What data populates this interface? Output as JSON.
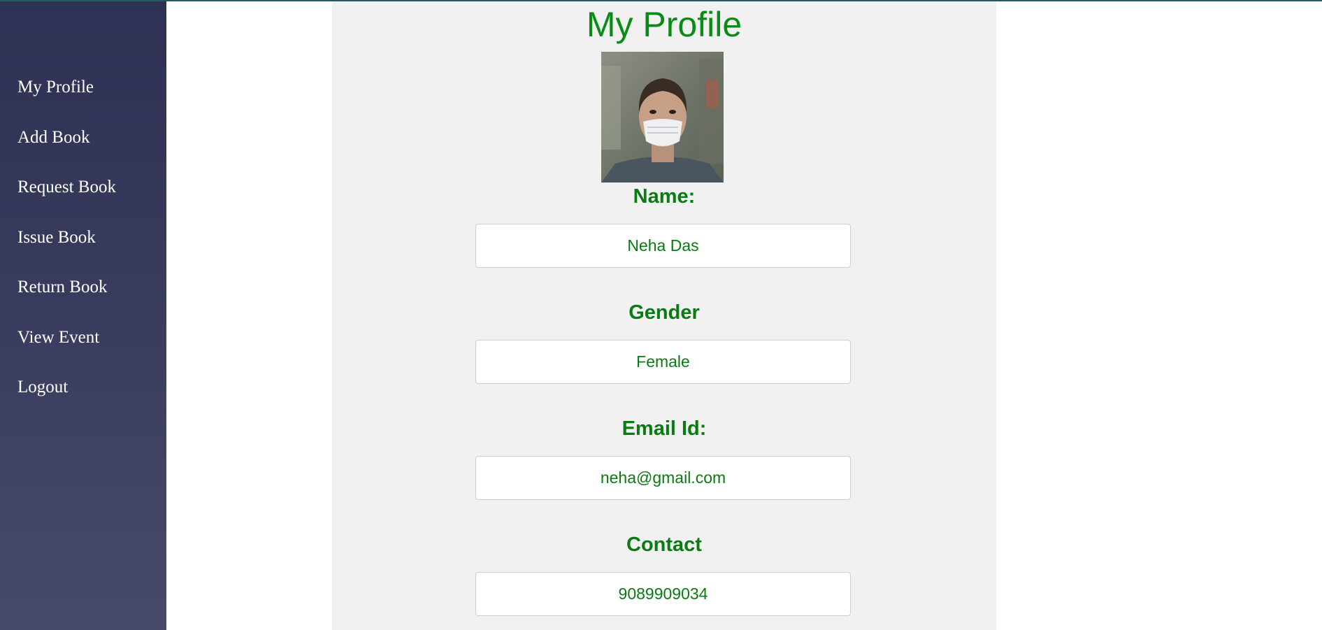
{
  "sidebar": {
    "items": [
      {
        "label": "My Profile"
      },
      {
        "label": "Add Book"
      },
      {
        "label": "Request Book"
      },
      {
        "label": "Issue Book"
      },
      {
        "label": "Return Book"
      },
      {
        "label": "View Event"
      },
      {
        "label": "Logout"
      }
    ]
  },
  "profile": {
    "title": "My Profile",
    "avatar_icon": "user-photo",
    "fields": {
      "name": {
        "label": "Name:",
        "value": "Neha Das"
      },
      "gender": {
        "label": "Gender",
        "value": "Female"
      },
      "email": {
        "label": "Email Id:",
        "value": "neha@gmail.com"
      },
      "contact": {
        "label": "Contact",
        "value": "9089909034"
      }
    }
  },
  "colors": {
    "sidebar_bg": "#383b5c",
    "accent_green": "#0a8a16",
    "panel_bg": "#f1f1f1"
  }
}
